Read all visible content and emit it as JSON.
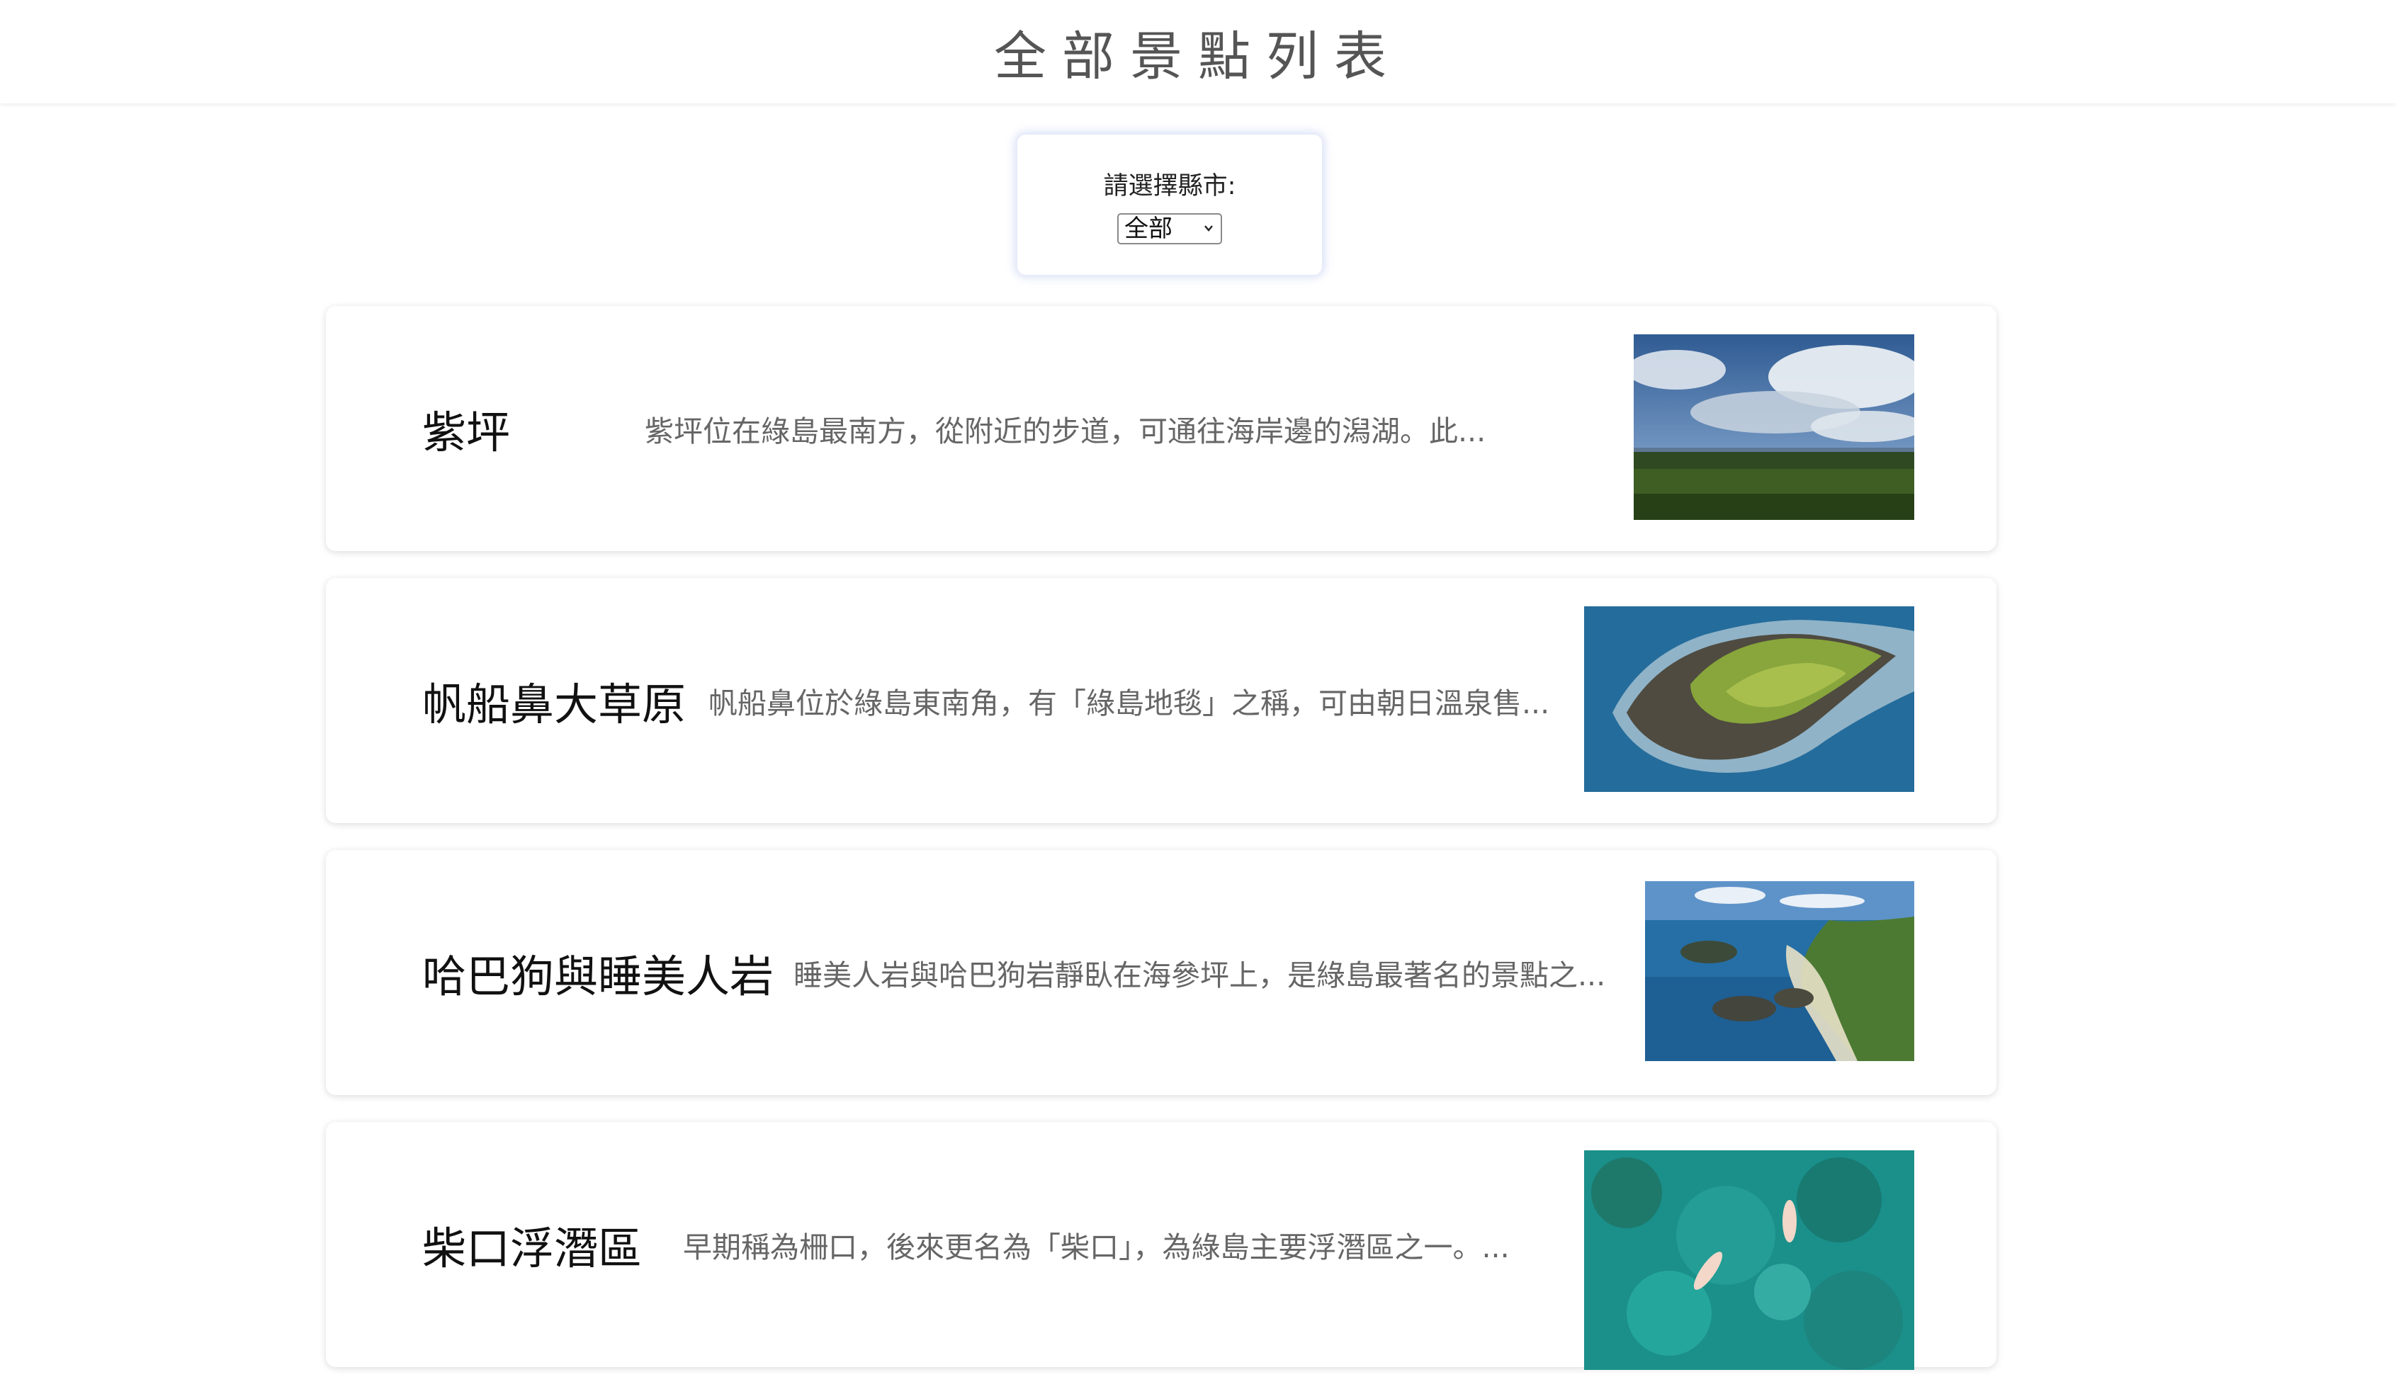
{
  "header": {
    "title": "全部景點列表"
  },
  "filter": {
    "label": "請選擇縣市:",
    "selected": "全部"
  },
  "attractions": [
    {
      "name": "紫坪",
      "description": "紫坪位在綠島最南方，從附近的步道，可通往海岸邊的潟湖。此..."
    },
    {
      "name": "帆船鼻大草原",
      "description": "帆船鼻位於綠島東南角，有「綠島地毯」之稱，可由朝日溫泉售..."
    },
    {
      "name": "哈巴狗與睡美人岩",
      "description": "睡美人岩與哈巴狗岩靜臥在海參坪上，是綠島最著名的景點之..."
    },
    {
      "name": "柴口浮潛區",
      "description": "早期稱為柵口，後來更名為「柴口」，為綠島主要浮潛區之一。..."
    }
  ]
}
